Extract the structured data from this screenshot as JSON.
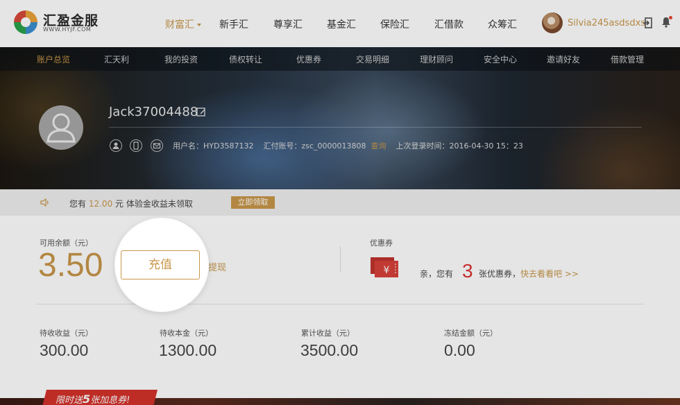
{
  "brand": {
    "name_cn": "汇盈金服",
    "domain": "WWW.HYJF.COM"
  },
  "main_nav": [
    {
      "label": "财富汇",
      "active": true
    },
    {
      "label": "新手汇"
    },
    {
      "label": "尊享汇"
    },
    {
      "label": "基金汇"
    },
    {
      "label": "保险汇"
    },
    {
      "label": "汇借款"
    },
    {
      "label": "众筹汇"
    }
  ],
  "user": {
    "username": "Silvia245asdsdxs"
  },
  "sub_nav": [
    {
      "label": "账户总览",
      "active": true
    },
    {
      "label": "汇天利"
    },
    {
      "label": "我的投资"
    },
    {
      "label": "债权转让"
    },
    {
      "label": "优惠券"
    },
    {
      "label": "交易明细"
    },
    {
      "label": "理财顾问"
    },
    {
      "label": "安全中心"
    },
    {
      "label": "邀请好友"
    },
    {
      "label": "借款管理"
    }
  ],
  "profile": {
    "display_name": "Jack37004488",
    "username_label": "用户名：",
    "username": "HYD3587132",
    "huifu_label": "汇付账号：",
    "huifu_account": "zsc_0000013808",
    "query_link": "查询",
    "last_login_label": "上次登录时间：",
    "last_login": "2016-04-30  15：23"
  },
  "notice": {
    "prefix": "您有",
    "amount": "12.00",
    "suffix": "元 体验金收益未领取",
    "button": "立即领取"
  },
  "account": {
    "balance_label": "可用余额（元）",
    "balance": "3.50",
    "recharge_button": "充值",
    "withdraw_link": "提现",
    "coupon_label": "优惠券",
    "coupon_prefix": "亲，您有",
    "coupon_count": "3",
    "coupon_suffix": "张优惠券，",
    "coupon_link": "快去看看吧 >>"
  },
  "stats": [
    {
      "label": "待收收益（元）",
      "value": "300.00"
    },
    {
      "label": "待收本金（元）",
      "value": "1300.00"
    },
    {
      "label": "累计收益（元）",
      "value": "3500.00"
    },
    {
      "label": "冻结金额（元）",
      "value": "0.00"
    }
  ],
  "promo": {
    "prefix": "限时送",
    "number": "5",
    "suffix": "张加息券!"
  },
  "colors": {
    "accent": "#c8974a",
    "alert": "#d33",
    "promo": "#d4312b"
  }
}
